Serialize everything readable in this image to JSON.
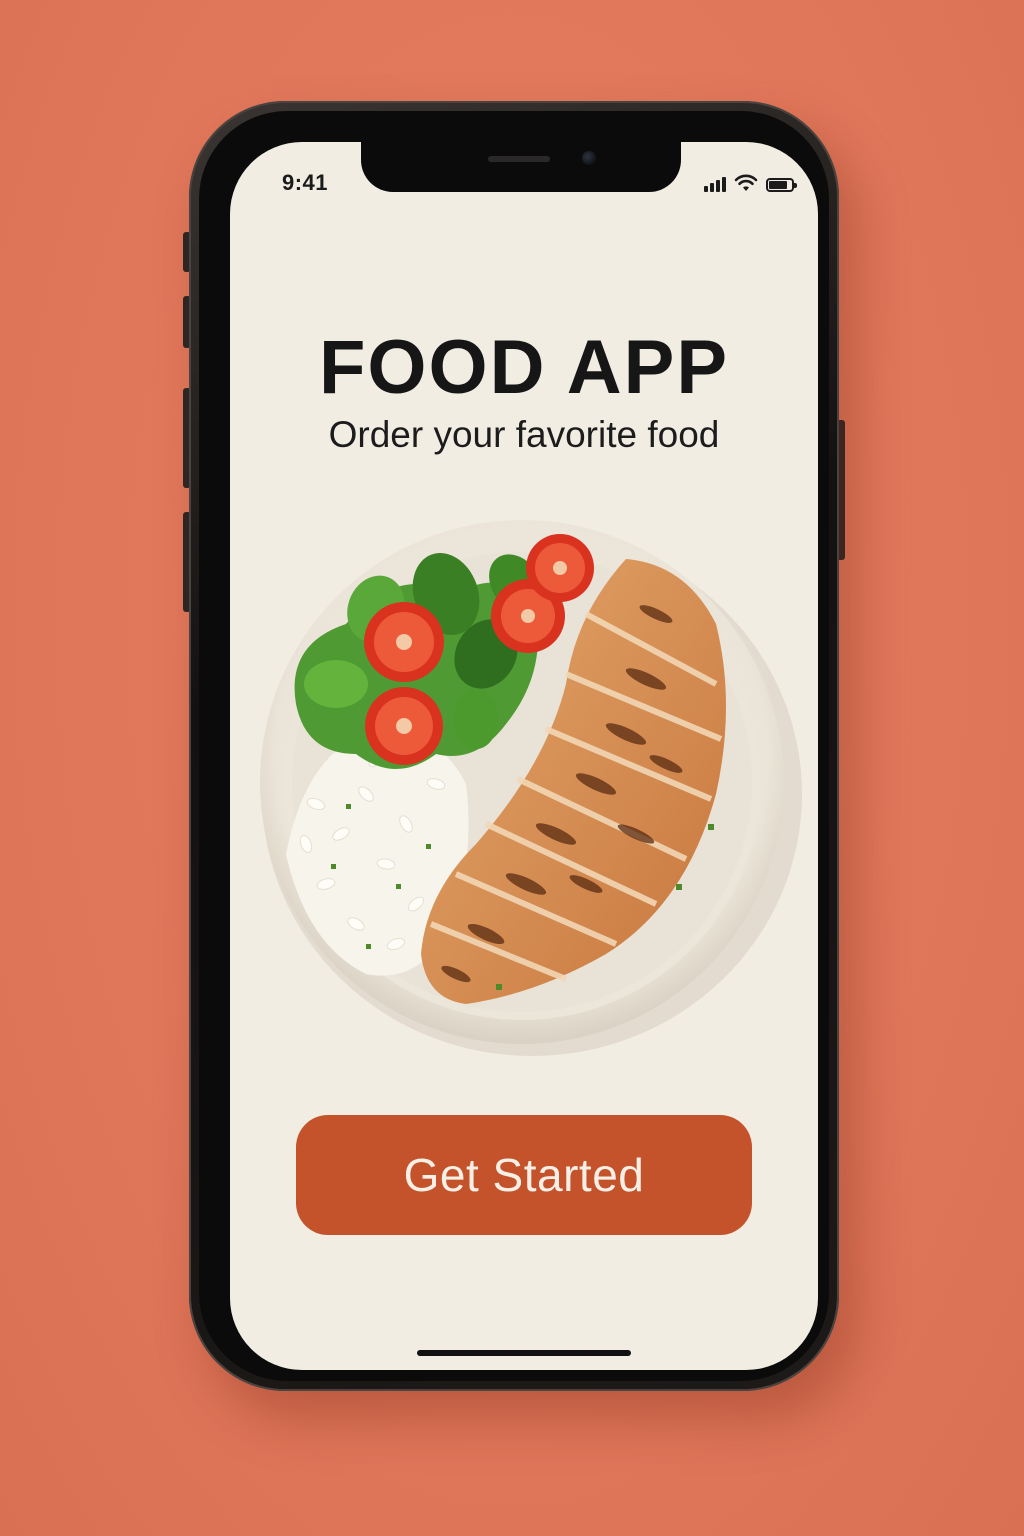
{
  "status_bar": {
    "time": "9:41",
    "signal_bars": 4,
    "battery_level": 0.9
  },
  "app": {
    "title": "FOOD APP",
    "subtitle": "Order your favorite food"
  },
  "hero_image": {
    "icon": "grilled-chicken-rice-salad-bowl"
  },
  "actions": {
    "get_started_label": "Get Started"
  },
  "colors": {
    "background": "#E2795A",
    "screen": "#F2EDE3",
    "accent": "#C4532C",
    "button_text": "#F6EFE6",
    "text": "#161616"
  }
}
